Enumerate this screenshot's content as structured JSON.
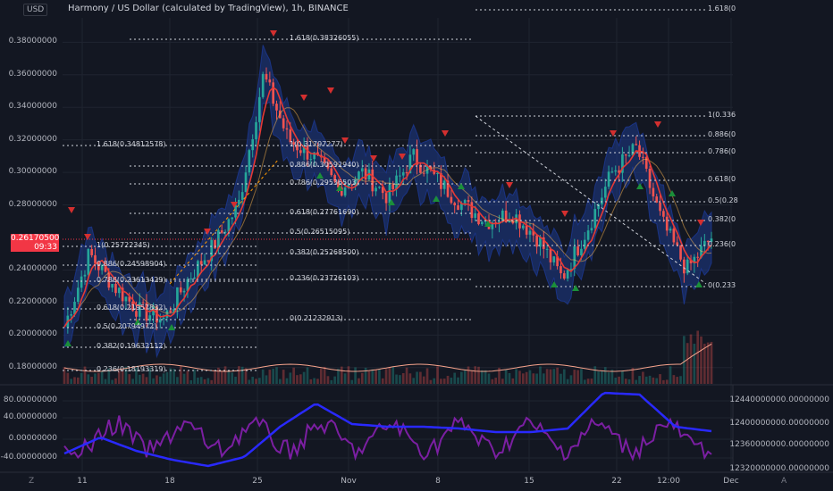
{
  "header": {
    "title": "Harmony / US Dollar (calculated by TradingView), 1h, BINANCE",
    "currency": "USD"
  },
  "last_price": {
    "value": "0.26170500",
    "countdown": "09:33"
  },
  "price_axis_labels": [
    "0.38000000",
    "0.36000000",
    "0.34000000",
    "0.32000000",
    "0.30000000",
    "0.28000000",
    "0.24000000",
    "0.22000000",
    "0.20000000",
    "0.18000000"
  ],
  "indicator_axis_labels": [
    "80.00000000",
    "40.00000000",
    "0.00000000",
    "-40.00000000"
  ],
  "indicator_right_axis_labels": [
    "12440000000.00000000",
    "12400000000.00000000",
    "12360000000.00000000",
    "12320000000.00000000"
  ],
  "time_axis_labels": [
    "11",
    "18",
    "25",
    "Nov",
    "8",
    "15",
    "22",
    "12:00",
    "Dec"
  ],
  "bottom_controls": {
    "left": "Z",
    "right": "A"
  },
  "fib_left": [
    {
      "text": "1.618(0.34812578)"
    },
    {
      "text": "1(0.25722345)"
    },
    {
      "text": "0.886(0.24598904)"
    },
    {
      "text": "0.786(0.23613429)"
    },
    {
      "text": "0.618(0.21957832)"
    },
    {
      "text": "0.5(0.20794972)"
    },
    {
      "text": "0.382(0.19632112)"
    },
    {
      "text": "0.236(0.18193319)"
    }
  ],
  "fib_mid": [
    {
      "text": "1.618(0.38326055)"
    },
    {
      "text": "1(0.31797277)"
    },
    {
      "text": "0.886(0.30592940)"
    },
    {
      "text": "0.786(0.29536503)"
    },
    {
      "text": "0.618(0.27761690)"
    },
    {
      "text": "0.5(0.26515095)"
    },
    {
      "text": "0.382(0.25268500)"
    },
    {
      "text": "0.236(0.23726103)"
    },
    {
      "text": "0(0.21232913)"
    }
  ],
  "fib_right": [
    {
      "text": "1.618(0"
    },
    {
      "text": "1(0.336"
    },
    {
      "text": "0.886(0"
    },
    {
      "text": "0.786(0"
    },
    {
      "text": "0.618(0"
    },
    {
      "text": "0.5(0.28"
    },
    {
      "text": "0.382(0"
    },
    {
      "text": "0.236(0"
    },
    {
      "text": "0(0.233"
    }
  ],
  "colors": {
    "background": "#131722",
    "up": "#26a69a",
    "down": "#ef5350",
    "band": "#1e3a8a",
    "indicator_blue": "#2929ff",
    "indicator_purple": "#7b1fa2",
    "volume_line": "#f6a38c",
    "sell_marker": "#d32f2f",
    "buy_marker": "#1b8f3a",
    "price_tag": "#f23645"
  },
  "chart_data": {
    "type": "line",
    "title": "Harmony / US Dollar (calculated by TradingView), 1h, BINANCE",
    "ylim": [
      0.17,
      0.395
    ],
    "x": [
      "11",
      "18",
      "25",
      "Nov",
      "8",
      "15",
      "22",
      "12:00"
    ],
    "series": [
      {
        "values": [
          0.205,
          0.25,
          0.23,
          0.215,
          0.21,
          0.235,
          0.255,
          0.28,
          0.36,
          0.32,
          0.31,
          0.29,
          0.3,
          0.285,
          0.31,
          0.295,
          0.28,
          0.27,
          0.275,
          0.26,
          0.235,
          0.265,
          0.3,
          0.315,
          0.27,
          0.24,
          0.26
        ]
      }
    ]
  }
}
